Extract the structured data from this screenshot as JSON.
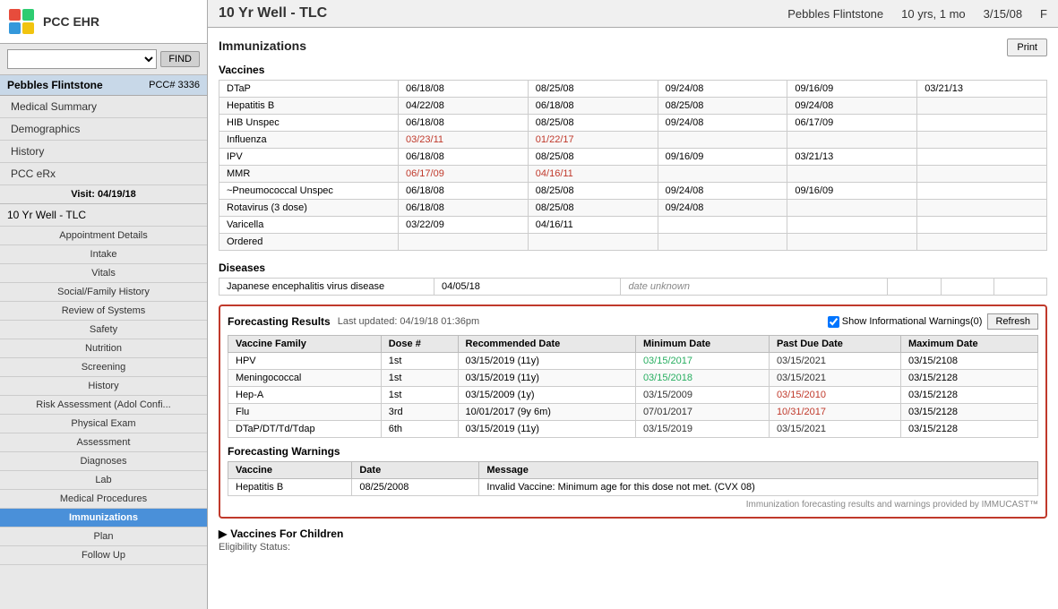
{
  "app": {
    "title": "PCC EHR",
    "logo_icon": "plus-icon"
  },
  "search": {
    "placeholder": "",
    "find_button": "FIND"
  },
  "patient": {
    "name": "Pebbles Flintstone",
    "pcc_number": "PCC# 3336",
    "age": "10 yrs, 1 mo",
    "dob": "3/15/08",
    "sex": "F"
  },
  "sidebar": {
    "nav_items": [
      {
        "label": "Medical Summary"
      },
      {
        "label": "Demographics"
      },
      {
        "label": "History"
      },
      {
        "label": "PCC eRx"
      }
    ],
    "visit_header": "Visit: 04/19/18",
    "visit_name": "10 Yr Well - TLC",
    "visit_nav_items": [
      {
        "label": "Appointment Details"
      },
      {
        "label": "Intake"
      },
      {
        "label": "Vitals"
      },
      {
        "label": "Social/Family History"
      },
      {
        "label": "Review of Systems"
      },
      {
        "label": "Safety"
      },
      {
        "label": "Nutrition"
      },
      {
        "label": "Screening"
      },
      {
        "label": "History"
      },
      {
        "label": "Risk Assessment (Adol Confi..."
      },
      {
        "label": "Physical Exam"
      },
      {
        "label": "Assessment"
      },
      {
        "label": "Diagnoses"
      },
      {
        "label": "Lab"
      },
      {
        "label": "Medical Procedures"
      },
      {
        "label": "Immunizations",
        "active": true
      },
      {
        "label": "Plan"
      },
      {
        "label": "Follow Up"
      }
    ]
  },
  "main": {
    "visit_title": "10 Yr Well - TLC",
    "section_title": "Immunizations",
    "print_button": "Print",
    "vaccines_label": "Vaccines",
    "vaccines": [
      {
        "name": "DTaP",
        "dates": [
          "06/18/08",
          "08/25/08",
          "09/24/08",
          "09/16/09",
          "03/21/13"
        ]
      },
      {
        "name": "Hepatitis B",
        "dates": [
          "04/22/08",
          "06/18/08",
          "08/25/08",
          "09/24/08",
          "",
          ""
        ]
      },
      {
        "name": "HIB Unspec",
        "dates": [
          "06/18/08",
          "08/25/08",
          "09/24/08",
          "06/17/09",
          ""
        ]
      },
      {
        "name": "Influenza",
        "dates": [
          "03/23/11",
          "01/22/17",
          "",
          "",
          ""
        ]
      },
      {
        "name": "IPV",
        "dates": [
          "06/18/08",
          "08/25/08",
          "09/16/09",
          "03/21/13",
          ""
        ]
      },
      {
        "name": "MMR",
        "dates": [
          "06/17/09",
          "04/16/11",
          "",
          "",
          ""
        ]
      },
      {
        "name": "~Pneumococcal Unspec",
        "dates": [
          "06/18/08",
          "08/25/08",
          "09/24/08",
          "09/16/09",
          ""
        ]
      },
      {
        "name": "Rotavirus (3 dose)",
        "dates": [
          "06/18/08",
          "08/25/08",
          "09/24/08",
          "",
          ""
        ]
      },
      {
        "name": "Varicella",
        "dates": [
          "03/22/09",
          "04/16/11",
          "",
          "",
          ""
        ]
      },
      {
        "name": "Ordered",
        "dates": [
          "",
          "",
          "",
          "",
          ""
        ]
      }
    ],
    "diseases_label": "Diseases",
    "diseases": [
      {
        "name": "Japanese encephalitis virus disease",
        "date1": "04/05/18",
        "date2": "date unknown"
      }
    ],
    "forecasting": {
      "title": "Forecasting Results",
      "last_updated": "Last updated: 04/19/18 01:36pm",
      "show_warnings_label": "Show Informational Warnings(0)",
      "refresh_button": "Refresh",
      "columns": [
        "Vaccine Family",
        "Dose #",
        "Recommended Date",
        "Minimum Date",
        "Past Due Date",
        "Maximum Date"
      ],
      "rows": [
        {
          "family": "HPV",
          "dose": "1st",
          "recommended": "03/15/2019 (11y)",
          "minimum": "03/15/2017",
          "past_due": "03/15/2021",
          "maximum": "03/15/2108",
          "minimum_color": "green",
          "past_due_color": "normal"
        },
        {
          "family": "Meningococcal",
          "dose": "1st",
          "recommended": "03/15/2019 (11y)",
          "minimum": "03/15/2018",
          "past_due": "03/15/2021",
          "maximum": "03/15/2128",
          "minimum_color": "green",
          "past_due_color": "normal"
        },
        {
          "family": "Hep-A",
          "dose": "1st",
          "recommended": "03/15/2009 (1y)",
          "minimum": "03/15/2009",
          "past_due": "03/15/2010",
          "maximum": "03/15/2128",
          "minimum_color": "normal",
          "past_due_color": "red"
        },
        {
          "family": "Flu",
          "dose": "3rd",
          "recommended": "10/01/2017 (9y 6m)",
          "minimum": "07/01/2017",
          "past_due": "10/31/2017",
          "maximum": "03/15/2128",
          "minimum_color": "normal",
          "past_due_color": "red"
        },
        {
          "family": "DTaP/DT/Td/Tdap",
          "dose": "6th",
          "recommended": "03/15/2019 (11y)",
          "minimum": "03/15/2019",
          "past_due": "03/15/2021",
          "maximum": "03/15/2128",
          "minimum_color": "normal",
          "past_due_color": "normal"
        }
      ],
      "warnings_label": "Forecasting Warnings",
      "warnings_columns": [
        "Vaccine",
        "Date",
        "Message"
      ],
      "warnings": [
        {
          "vaccine": "Hepatitis B",
          "date": "08/25/2008",
          "message": "Invalid Vaccine: Minimum age for this dose not met. (CVX 08)"
        }
      ],
      "immucast_note": "Immunization forecasting results and warnings provided by IMMUCAST™"
    },
    "vfc": {
      "title": "▶ Vaccines For Children",
      "subtitle": "Eligibility Status:"
    }
  }
}
